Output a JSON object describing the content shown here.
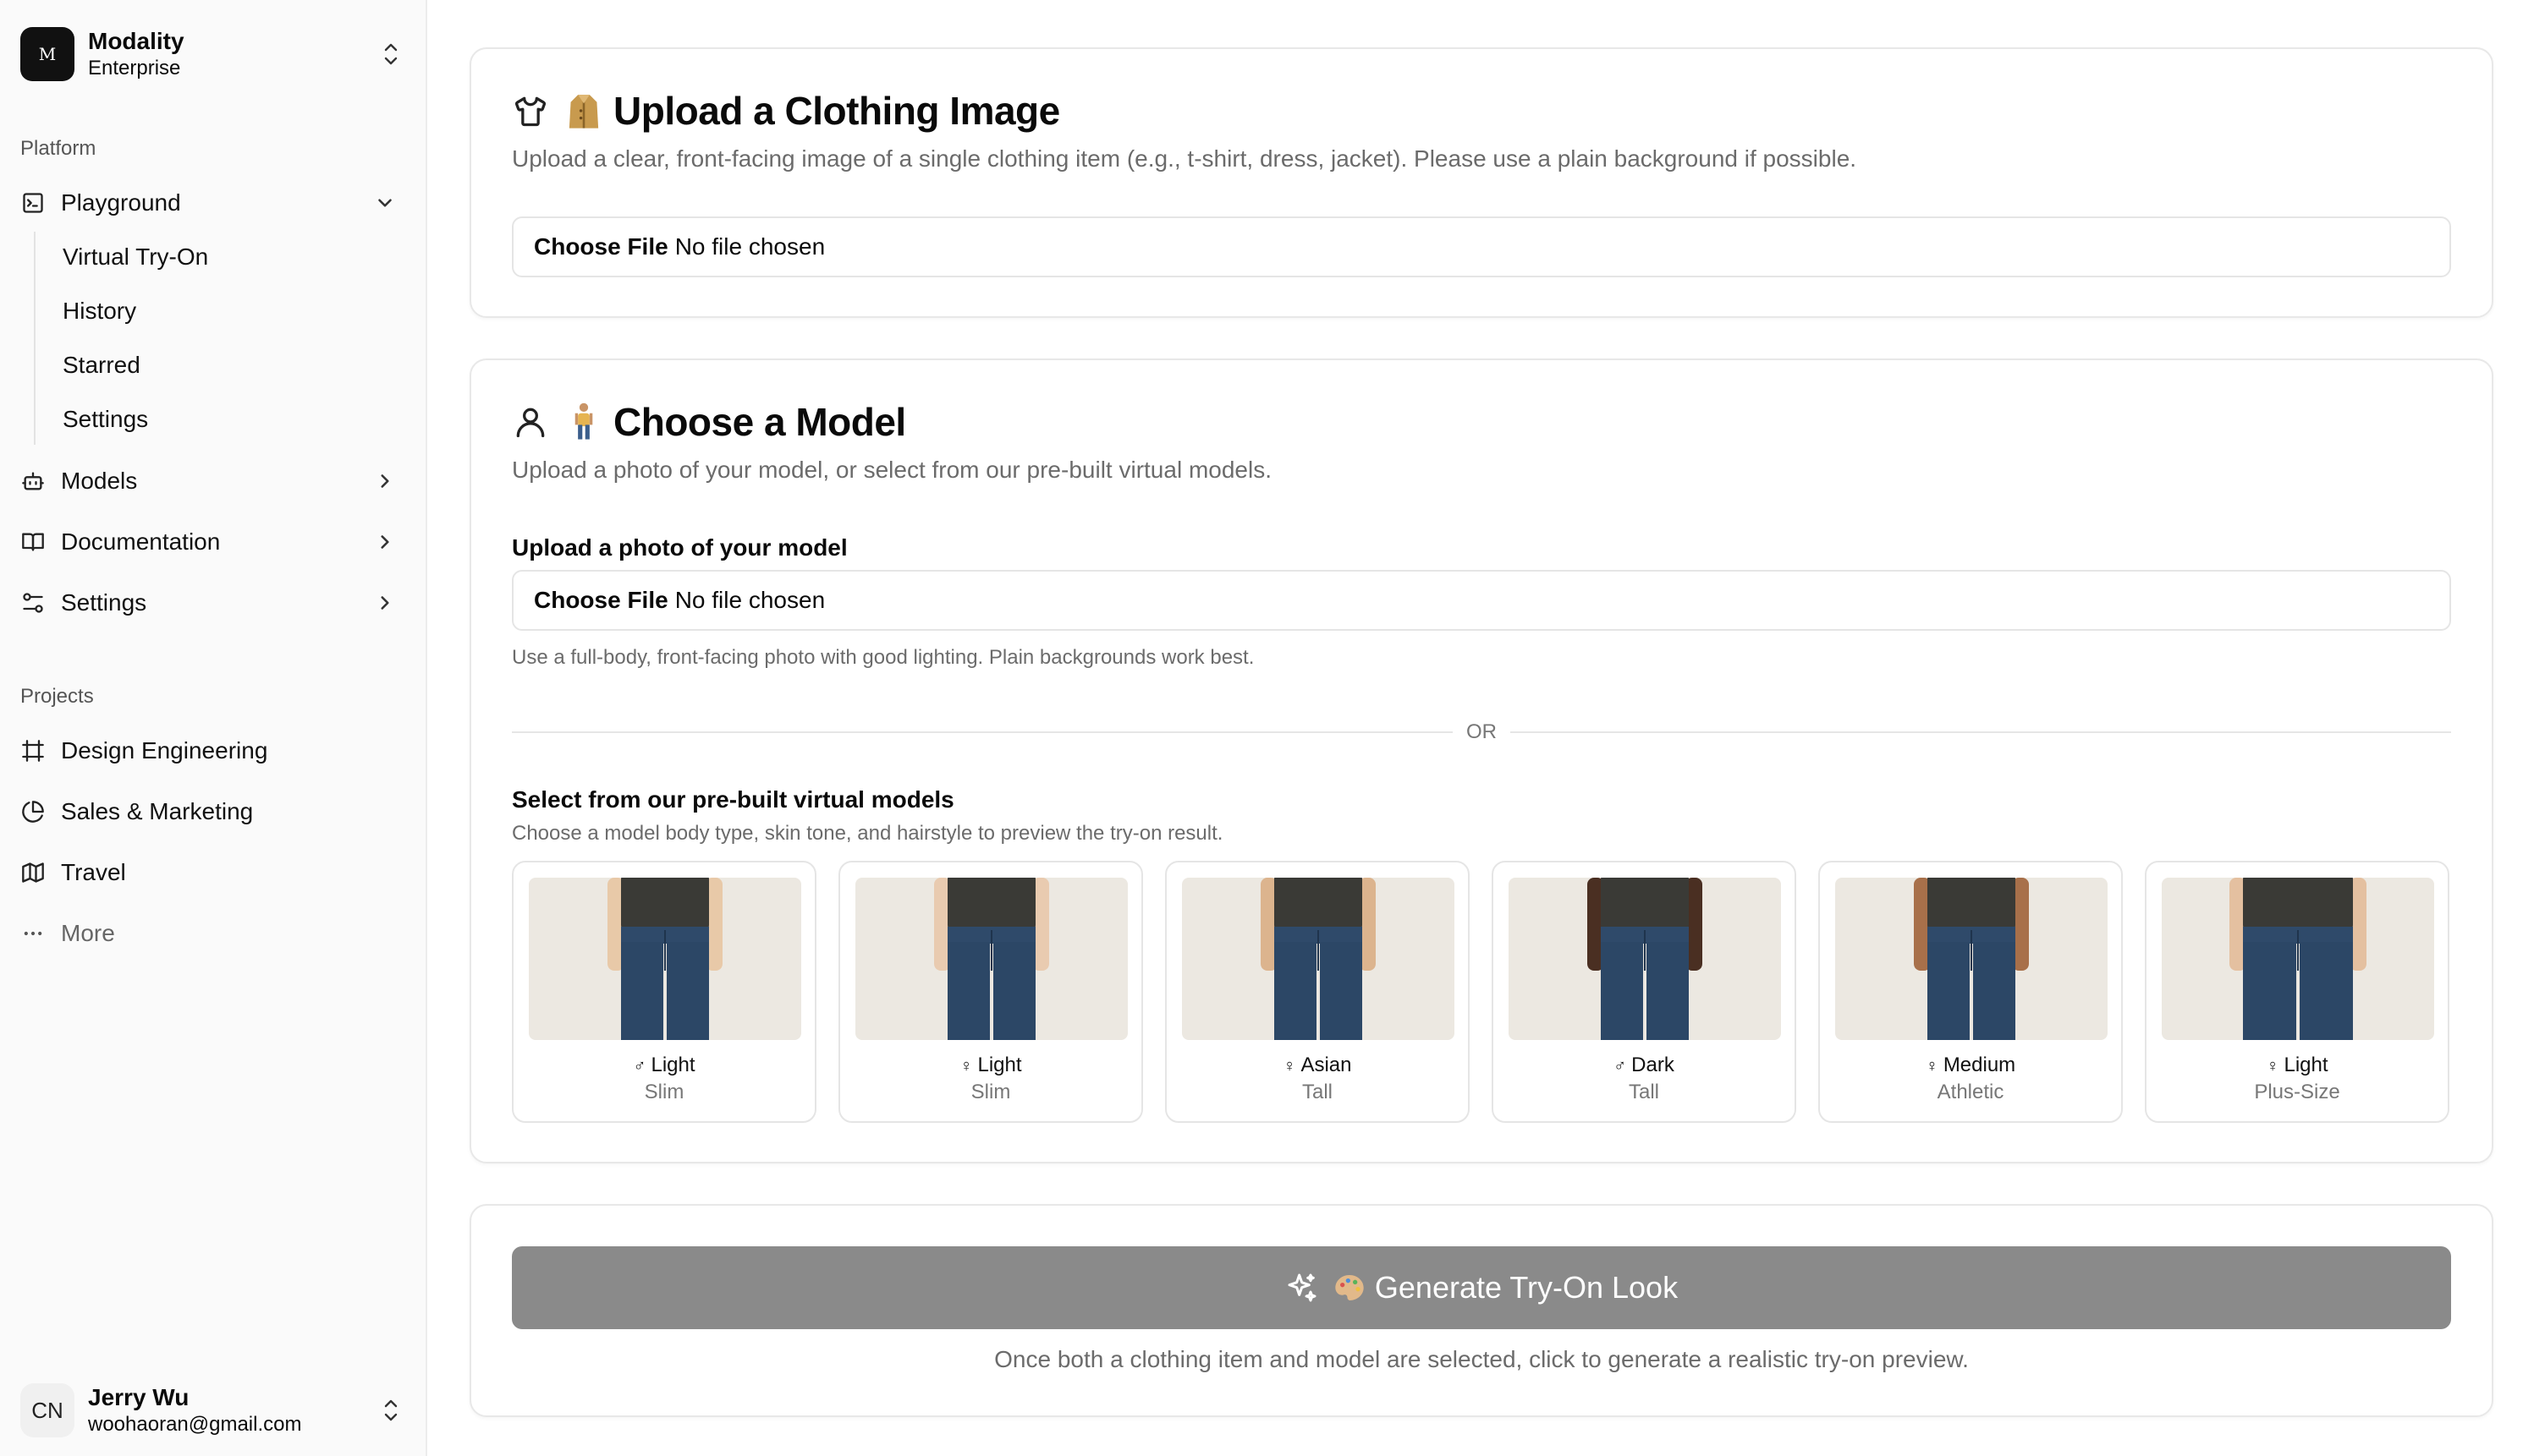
{
  "team": {
    "logo_letter": "M",
    "name": "Modality",
    "plan": "Enterprise"
  },
  "sidebar": {
    "platform_label": "Platform",
    "playground": {
      "label": "Playground",
      "children": [
        "Virtual Try-On",
        "History",
        "Starred",
        "Settings"
      ]
    },
    "items": [
      {
        "label": "Models",
        "icon": "bot-icon"
      },
      {
        "label": "Documentation",
        "icon": "book-icon"
      },
      {
        "label": "Settings",
        "icon": "sliders-icon"
      }
    ],
    "projects_label": "Projects",
    "projects": [
      {
        "label": "Design Engineering",
        "icon": "frame-icon"
      },
      {
        "label": "Sales & Marketing",
        "icon": "pie-chart-icon"
      },
      {
        "label": "Travel",
        "icon": "map-icon"
      }
    ],
    "more_label": "More"
  },
  "user": {
    "initials": "CN",
    "name": "Jerry Wu",
    "email": "woohaoran@gmail.com"
  },
  "upload_clothing": {
    "title": "Upload a Clothing Image",
    "subtitle": "Upload a clear, front-facing image of a single clothing item (e.g., t-shirt, dress, jacket). Please use a plain background if possible.",
    "file_button": "Choose File",
    "file_status": "No file chosen"
  },
  "choose_model": {
    "title": "Choose a Model",
    "subtitle": "Upload a photo of your model, or select from our pre-built virtual models.",
    "upload_label": "Upload a photo of your model",
    "file_button": "Choose File",
    "file_status": "No file chosen",
    "upload_hint": "Use a full-body, front-facing photo with good lighting. Plain backgrounds work best.",
    "or_text": "OR",
    "prebuilt_label": "Select from our pre-built virtual models",
    "prebuilt_hint": "Choose a model body type, skin tone, and hairstyle to preview the try-on result.",
    "models": [
      {
        "gender": "♂",
        "tone": "Light",
        "body": "Slim",
        "skin": "#e8c9a8"
      },
      {
        "gender": "♀",
        "tone": "Light",
        "body": "Slim",
        "skin": "#e9cbb0"
      },
      {
        "gender": "♀",
        "tone": "Asian",
        "body": "Tall",
        "skin": "#dcb48e"
      },
      {
        "gender": "♂",
        "tone": "Dark",
        "body": "Tall",
        "skin": "#4a2f22"
      },
      {
        "gender": "♀",
        "tone": "Medium",
        "body": "Athletic",
        "skin": "#a8704a"
      },
      {
        "gender": "♀",
        "tone": "Light",
        "body": "Plus-Size",
        "skin": "#e4c0a0"
      }
    ]
  },
  "generate": {
    "label": "Generate Try-On Look",
    "note": "Once both a clothing item and model are selected, click to generate a realistic try-on preview."
  }
}
